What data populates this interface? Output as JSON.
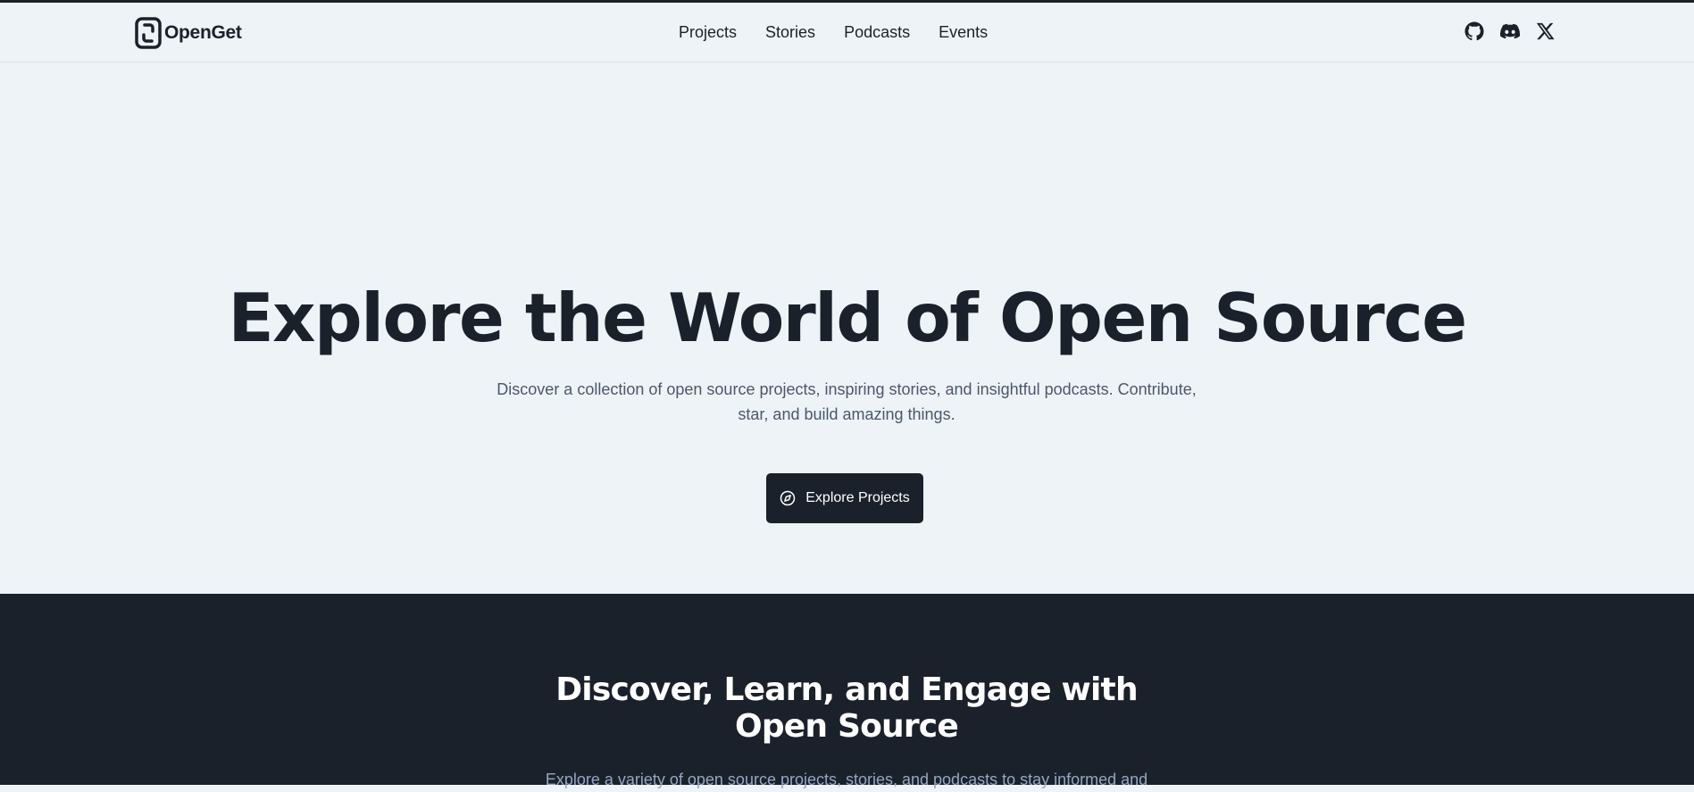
{
  "brand": {
    "name": "OpenGet"
  },
  "nav": {
    "items": [
      {
        "label": "Projects"
      },
      {
        "label": "Stories"
      },
      {
        "label": "Podcasts"
      },
      {
        "label": "Events"
      }
    ]
  },
  "socials": {
    "items": [
      {
        "icon": "github-icon"
      },
      {
        "icon": "discord-icon"
      },
      {
        "icon": "x-icon"
      }
    ]
  },
  "hero": {
    "title": "Explore the World of Open Source",
    "subtitle": "Discover a collection of open source projects, inspiring stories, and insightful podcasts. Contribute, star, and build amazing things.",
    "cta_label": "Explore Projects",
    "cta_icon": "compass-icon"
  },
  "section": {
    "title": "Discover, Learn, and Engage with Open Source",
    "text": "Explore a variety of open source projects, stories, and podcasts to stay informed and"
  },
  "colors": {
    "background": "#eef3f7",
    "dark": "#1b212b",
    "muted_text": "#4b586a",
    "section_text": "#93a6c3"
  }
}
